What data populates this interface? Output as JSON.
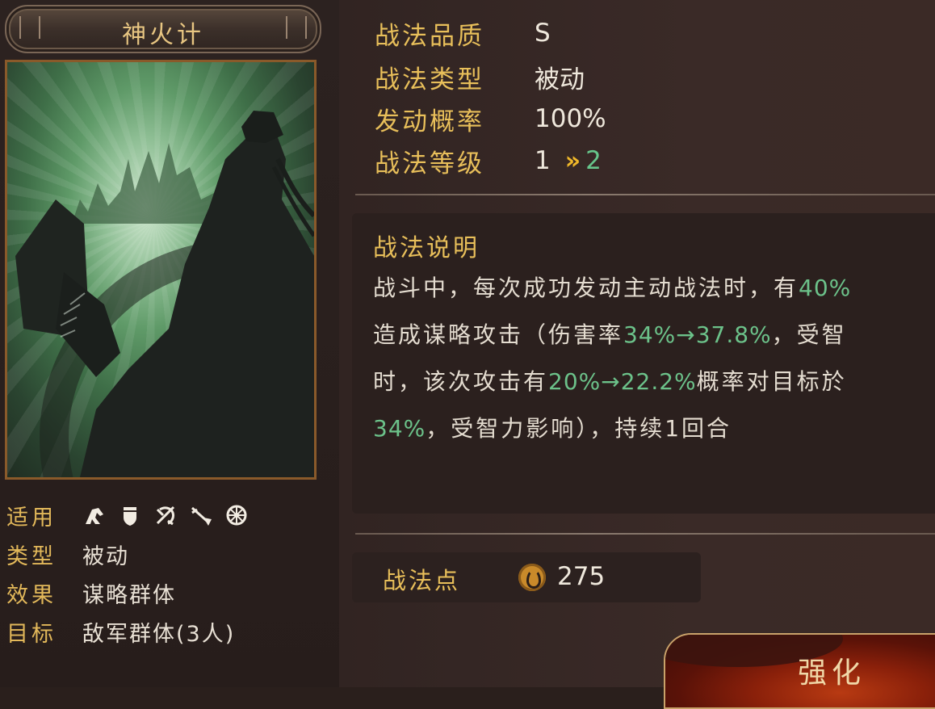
{
  "skill": {
    "name": "神火计"
  },
  "left_info": {
    "rows": [
      {
        "label": "适用",
        "value": ""
      },
      {
        "label": "类型",
        "value": "被动"
      },
      {
        "label": "效果",
        "value": "谋略群体"
      },
      {
        "label": "目标",
        "value": "敌军群体(3人)"
      }
    ],
    "unit_icons": [
      "cavalry-icon",
      "shield-icon",
      "archer-icon",
      "spear-icon",
      "siege-icon"
    ]
  },
  "stats": {
    "quality": {
      "label": "战法品质",
      "value": "S"
    },
    "type": {
      "label": "战法类型",
      "value": "被动"
    },
    "rate": {
      "label": "发动概率",
      "value": "100%"
    },
    "level": {
      "label": "战法等级",
      "current": "1",
      "arrow": "»",
      "next": "2"
    }
  },
  "description": {
    "title": "战法说明",
    "lines": [
      [
        {
          "t": "战斗中，每次成功发动主动战法时，有"
        },
        {
          "t": "40%",
          "hl": true
        }
      ],
      [
        {
          "t": "造成谋略攻击（伤害率"
        },
        {
          "t": "34%→37.8%",
          "hl": true
        },
        {
          "t": "，受智"
        }
      ],
      [
        {
          "t": "时，该次攻击有"
        },
        {
          "t": "20%→22.2%",
          "hl": true
        },
        {
          "t": "概率对目标於"
        }
      ],
      [
        {
          "t": "34%",
          "hl": true
        },
        {
          "t": "，受智力影响），持续1回合"
        }
      ]
    ]
  },
  "points": {
    "label": "战法点",
    "value": "275"
  },
  "actions": {
    "upgrade_label": "强化"
  },
  "colors": {
    "gold_label": "#e8bf5a",
    "highlight_green": "#6cc28a",
    "background": "#2a1f1c"
  }
}
